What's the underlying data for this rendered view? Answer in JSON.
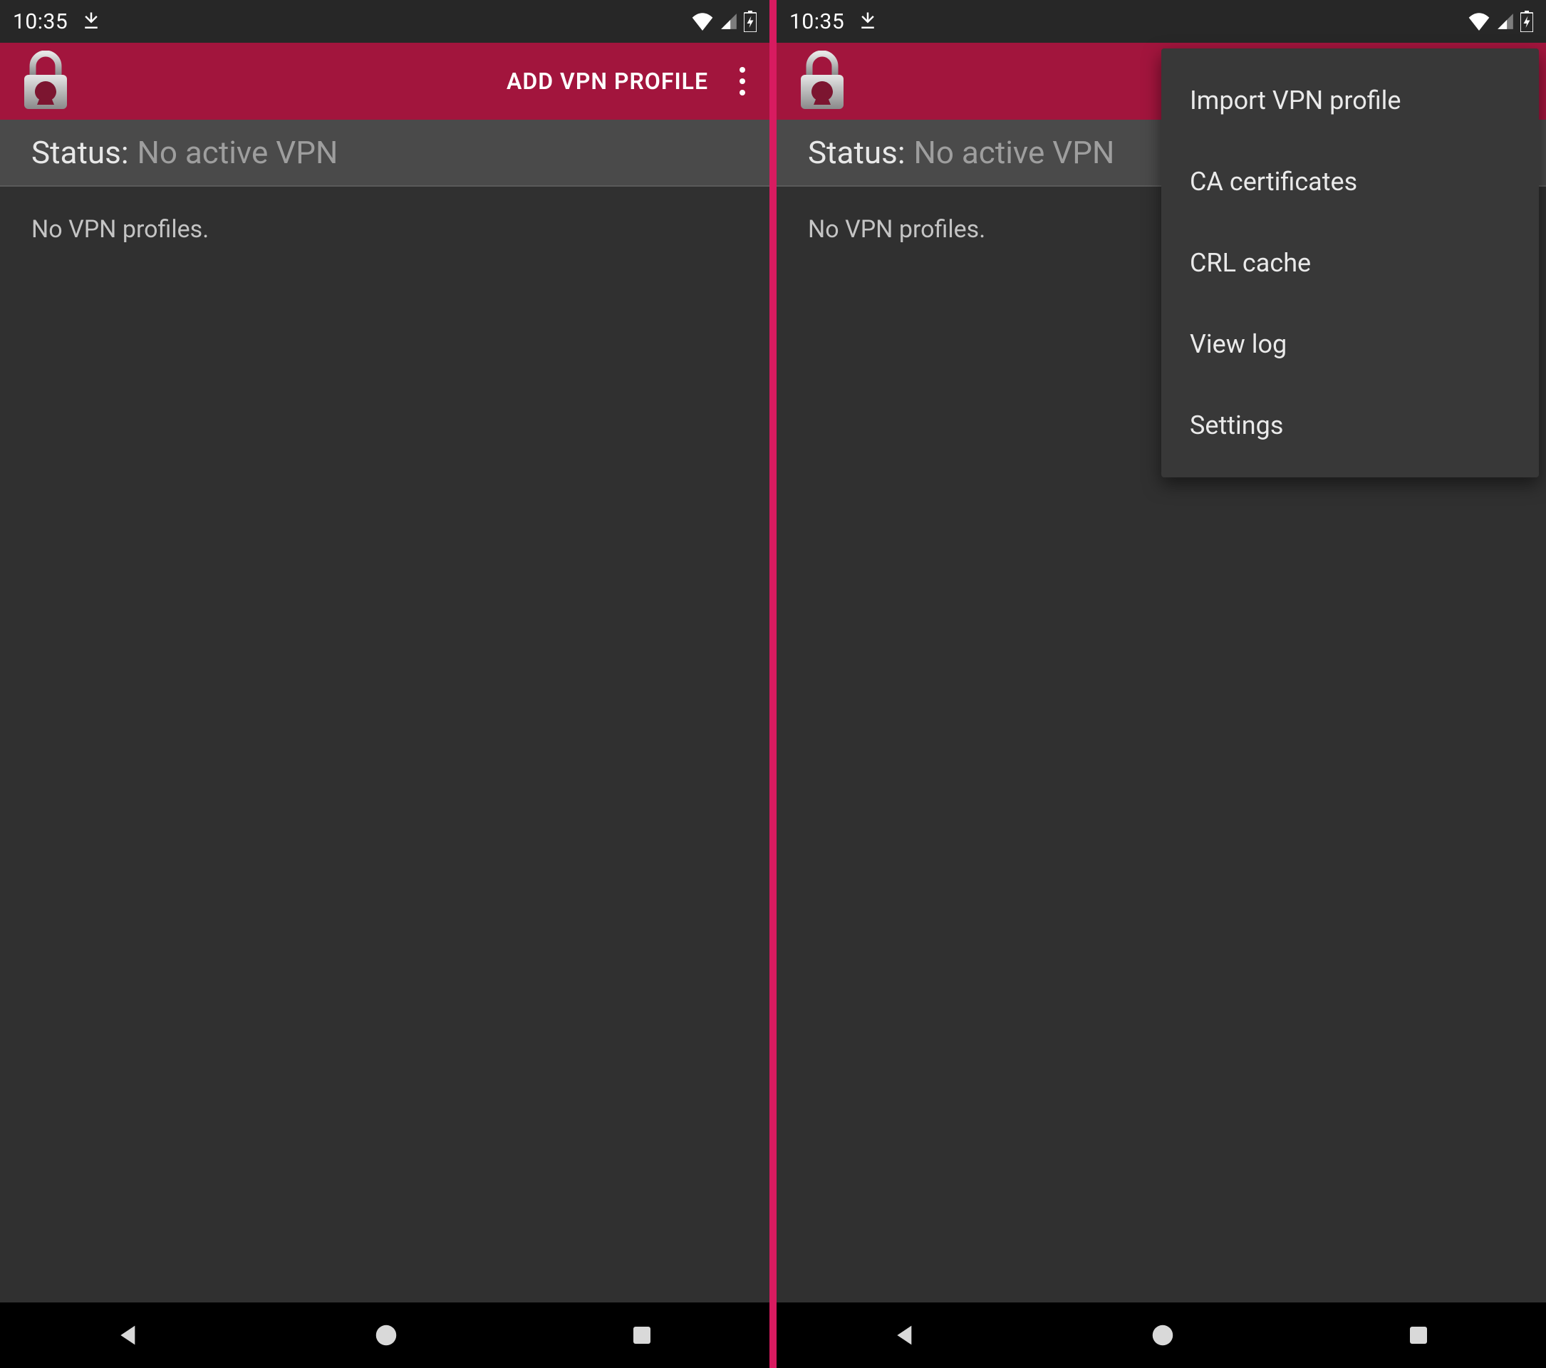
{
  "statusbar": {
    "time": "10:35"
  },
  "appbar": {
    "add_label": "ADD VPN PROFILE"
  },
  "status": {
    "label": "Status:",
    "value": "No active VPN"
  },
  "body": {
    "empty_msg": "No VPN profiles."
  },
  "menu": {
    "items": [
      "Import VPN profile",
      "CA certificates",
      "CRL cache",
      "View log",
      "Settings"
    ]
  }
}
